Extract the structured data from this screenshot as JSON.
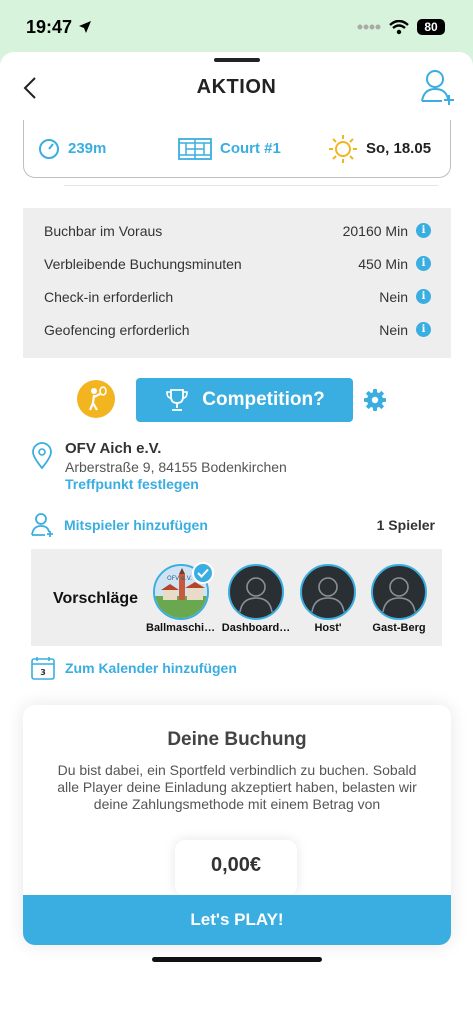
{
  "status": {
    "time": "19:47",
    "battery": "80"
  },
  "nav": {
    "title": "AKTION"
  },
  "summary": {
    "distance": "239m",
    "court": "Court #1",
    "date": "So, 18.05"
  },
  "details": [
    {
      "label": "Buchbar im Voraus",
      "value": "20160 Min"
    },
    {
      "label": "Verbleibende Buchungsminuten",
      "value": "450 Min"
    },
    {
      "label": "Check-in erforderlich",
      "value": "Nein"
    },
    {
      "label": "Geofencing erforderlich",
      "value": "Nein"
    }
  ],
  "competition": {
    "label": "Competition?"
  },
  "location": {
    "name": "OFV Aich e.V.",
    "address": "Arberstraße 9, 84155 Bodenkirchen",
    "link": "Treffpunkt festlegen"
  },
  "players": {
    "add_label": "Mitspieler hinzufügen",
    "count": "1 Spieler"
  },
  "suggestions": {
    "label": "Vorschläge",
    "items": [
      {
        "name": "Ballmaschine",
        "selected": true
      },
      {
        "name": "Dashboard…",
        "selected": false
      },
      {
        "name": "Host'",
        "selected": false
      },
      {
        "name": "Gast-Berg",
        "selected": false
      }
    ]
  },
  "calendar": {
    "label": "Zum Kalender hinzufügen",
    "day": "3"
  },
  "booking": {
    "title": "Deine Buchung",
    "text": "Du bist dabei, ein Sportfeld verbindlich zu buchen. Sobald alle Player deine Einladung akzeptiert haben, belasten wir deine Zahlungsmethode mit einem Betrag von",
    "price": "0,00€",
    "button": "Let's PLAY!"
  },
  "colors": {
    "accent": "#3aaee0",
    "badge": "#f2b520",
    "status_bg": "#d7f3dc"
  }
}
